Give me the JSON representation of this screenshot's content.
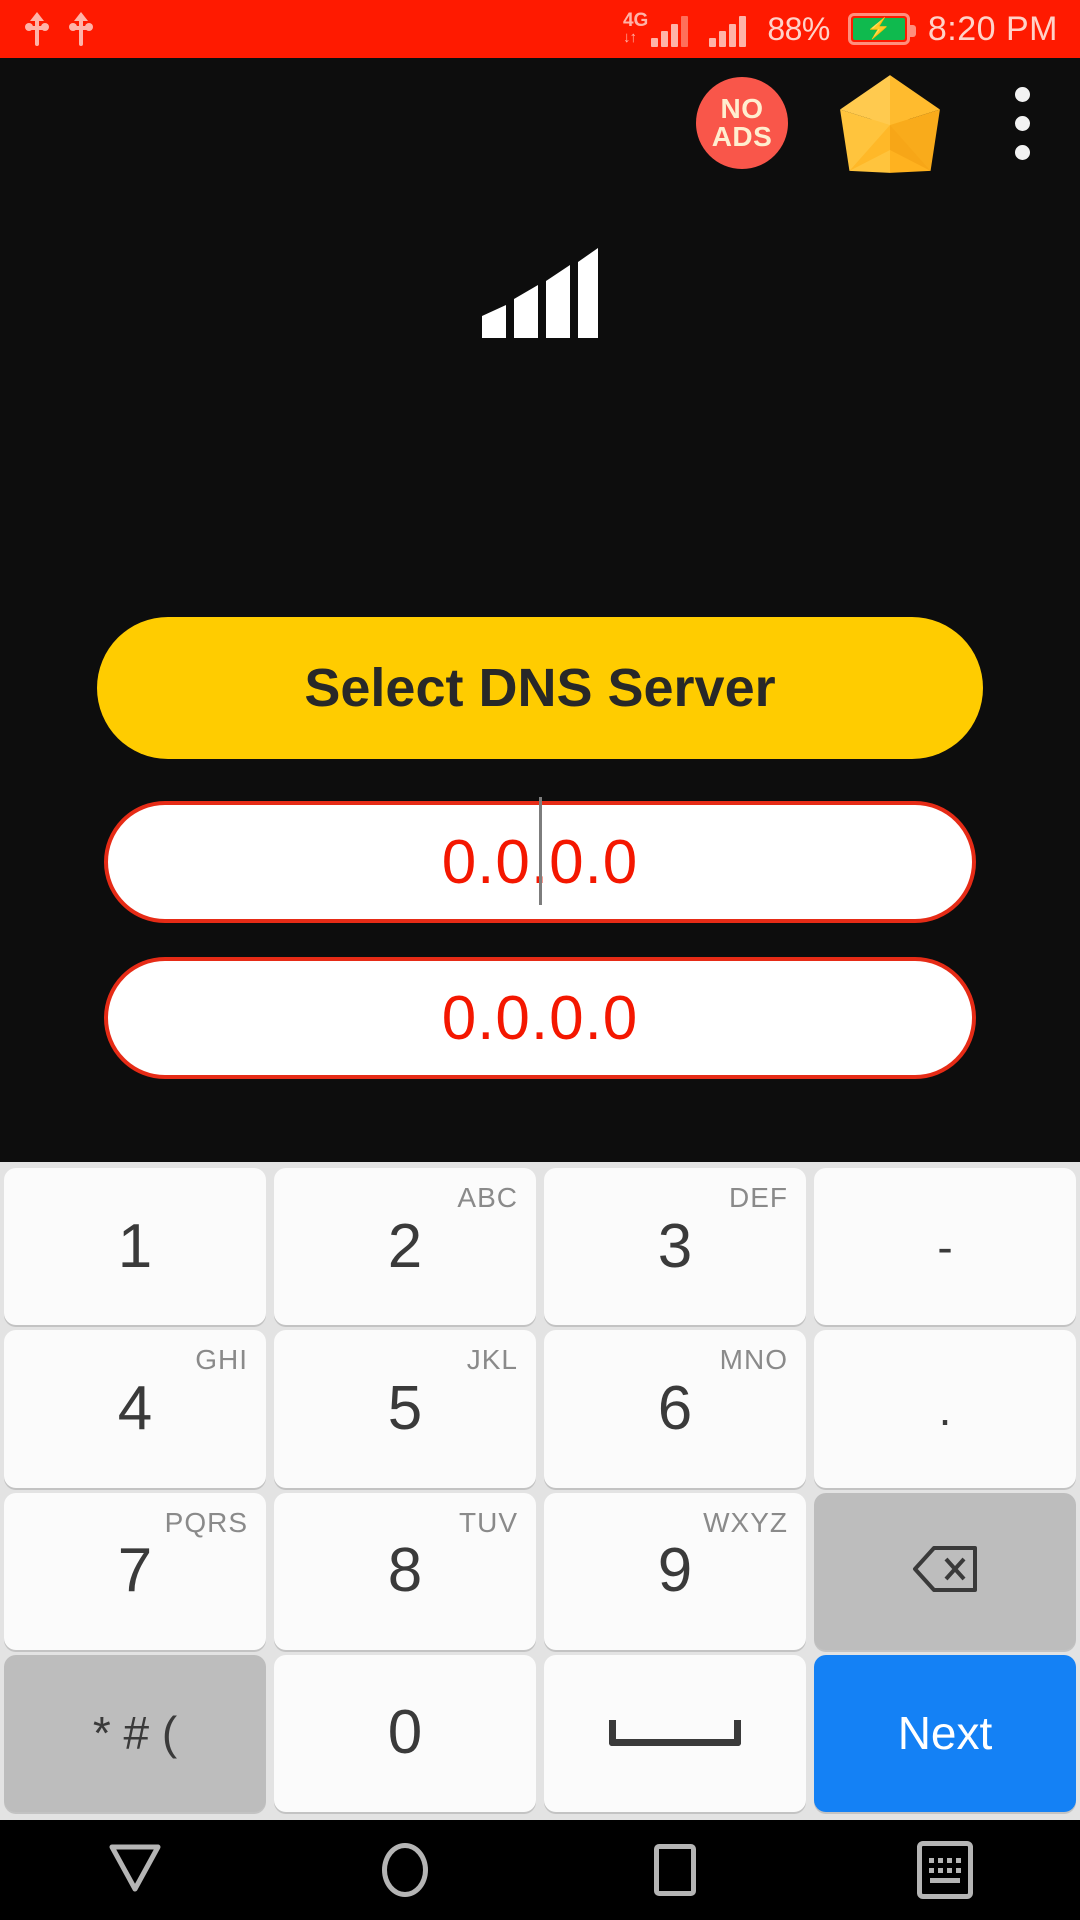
{
  "statusbar": {
    "usb_icon_1": "usb-icon",
    "usb_icon_2": "usb-icon",
    "network_type": "4G",
    "network_sub": "↓↑",
    "battery_percent": "88%",
    "battery_state": "charging",
    "clock": "8:20 PM",
    "bg_color": "#ff1a00",
    "text_color": "#ffd2c8"
  },
  "header": {
    "no_ads_line1": "NO",
    "no_ads_line2": "ADS",
    "no_ads_color": "#f9564a",
    "star_icon": "star-icon",
    "star_color": "#ffc02e",
    "menu_icon": "overflow-menu-icon"
  },
  "main": {
    "signal_icon": "signal-bars-icon",
    "select_button_label": "Select DNS Server",
    "select_button_color": "#ffcc00",
    "dns_primary": "0.0.0.0",
    "dns_secondary": "0.0.0.0",
    "dns_text_color": "#f41700",
    "field_border_color": "#e62b16",
    "background_color": "#0d0d0d"
  },
  "keyboard": {
    "bg_color": "#e3e3e3",
    "key_color": "#fbfbfb",
    "accent_color": "#1481f5",
    "rows": [
      [
        {
          "digit": "1",
          "letters": "",
          "name": "key-1",
          "type": "digit"
        },
        {
          "digit": "2",
          "letters": "ABC",
          "name": "key-2",
          "type": "digit"
        },
        {
          "digit": "3",
          "letters": "DEF",
          "name": "key-3",
          "type": "digit"
        },
        {
          "digit": "-",
          "letters": "",
          "name": "key-dash",
          "type": "symbol"
        }
      ],
      [
        {
          "digit": "4",
          "letters": "GHI",
          "name": "key-4",
          "type": "digit"
        },
        {
          "digit": "5",
          "letters": "JKL",
          "name": "key-5",
          "type": "digit"
        },
        {
          "digit": "6",
          "letters": "MNO",
          "name": "key-6",
          "type": "digit"
        },
        {
          "digit": ".",
          "letters": "",
          "name": "key-period",
          "type": "symbol"
        }
      ],
      [
        {
          "digit": "7",
          "letters": "PQRS",
          "name": "key-7",
          "type": "digit"
        },
        {
          "digit": "8",
          "letters": "TUV",
          "name": "key-8",
          "type": "digit"
        },
        {
          "digit": "9",
          "letters": "WXYZ",
          "name": "key-9",
          "type": "digit"
        },
        {
          "digit": "",
          "letters": "",
          "name": "key-backspace",
          "type": "backspace"
        }
      ],
      [
        {
          "digit": "* # (",
          "letters": "",
          "name": "key-symbols",
          "type": "symbols-grey"
        },
        {
          "digit": "0",
          "letters": "",
          "name": "key-0",
          "type": "digit"
        },
        {
          "digit": "",
          "letters": "",
          "name": "key-space",
          "type": "space"
        },
        {
          "digit": "Next",
          "letters": "",
          "name": "key-next",
          "type": "action"
        }
      ]
    ]
  },
  "navbar": {
    "back": "back-icon",
    "home": "home-icon",
    "recents": "recents-icon",
    "keyboard_toggle": "keyboard-toggle-icon"
  }
}
